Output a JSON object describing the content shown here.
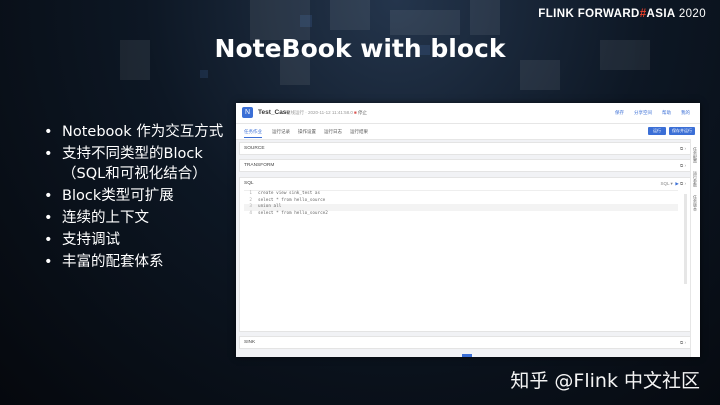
{
  "brand": {
    "name": "FLINK FORWARD",
    "hash": "#",
    "region": "ASIA",
    "year": "2020"
  },
  "slide": {
    "title": "NoteBook with block",
    "bullets": [
      "Notebook 作为交互方式",
      "支持不同类型的Block（SQL和可视化结合）",
      "Block类型可扩展",
      "连续的上下文",
      "支持调试",
      "丰富的配套体系"
    ]
  },
  "notebook": {
    "name": "Test_Case",
    "meta": "在线运行 · 2020-11-12 11:41:58.0",
    "status": "停止",
    "top_links": [
      "保存",
      "分享空间",
      "帮助",
      "我的"
    ],
    "tabs": [
      "任务作业",
      "运行记录",
      "操作设置",
      "运行日志",
      "运行结果"
    ],
    "actions": {
      "run": "运行",
      "save_run": "保存并运行"
    },
    "side_panel": [
      "任务配置",
      "运行参数",
      "任务版本"
    ],
    "blocks": {
      "source": "SOURCE",
      "transform": "TRANSFORM",
      "sql": "SQL",
      "sink": "SINK"
    },
    "sql_language": "SQL",
    "code_lines": [
      {
        "n": "1",
        "text": "create view sink_test as"
      },
      {
        "n": "2",
        "text": "select * from hello_source"
      },
      {
        "n": "3",
        "text": "union all"
      },
      {
        "n": "4",
        "text": "select * from hello_source2"
      }
    ],
    "block_icons": "⧉ ›"
  },
  "watermark": "知乎 @Flink 中文社区"
}
